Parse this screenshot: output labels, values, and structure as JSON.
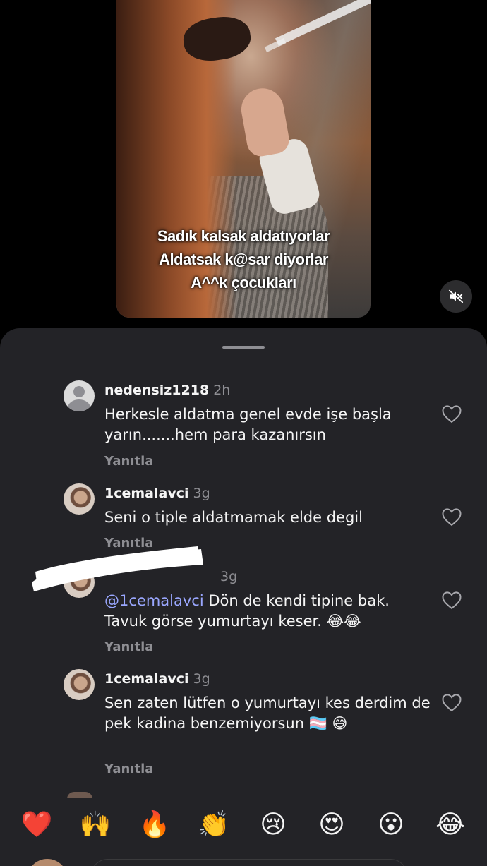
{
  "video": {
    "caption": [
      "Sadık kalsak aldatıyorlar",
      "Aldatsak k@sar diyorlar",
      "A^^k çocukları"
    ],
    "mute_icon": "speaker-muted-icon"
  },
  "comments": [
    {
      "username": "nedensiz1218",
      "time": "2h",
      "text": "Herkesle aldatma genel evde işe başla yarın.......hem para kazanırsın",
      "reply": "Yanıtla",
      "avatar": "default-avatar"
    },
    {
      "username": "1cemalavci",
      "time": "3g",
      "text": "Seni o tiple aldatmamak elde degil",
      "reply": "Yanıtla",
      "avatar": "photo-avatar"
    },
    {
      "username": "",
      "time": "3g",
      "mention": "@1cemalavci",
      "text": " Dön de kendi tipine bak. Tavuk görse yumurtayı keser. 😂😂",
      "reply": "Yanıtla",
      "avatar": "photo-avatar"
    },
    {
      "username": "1cemalavci",
      "time": "3g",
      "text": "Sen zaten lütfen o yumurtayı kes derdim de pek kadina benzemiyorsun 🏳️‍⚧️ 😅",
      "reply": "Yanıtla",
      "avatar": "photo-avatar"
    }
  ],
  "reactions": [
    "❤️",
    "🙌",
    "🔥",
    "👏",
    "😢",
    "😍",
    "😮",
    "😂"
  ],
  "colors": {
    "sheet_bg": "#232327",
    "mention": "#9aa7ff",
    "secondary_text": "#8e8e93"
  }
}
